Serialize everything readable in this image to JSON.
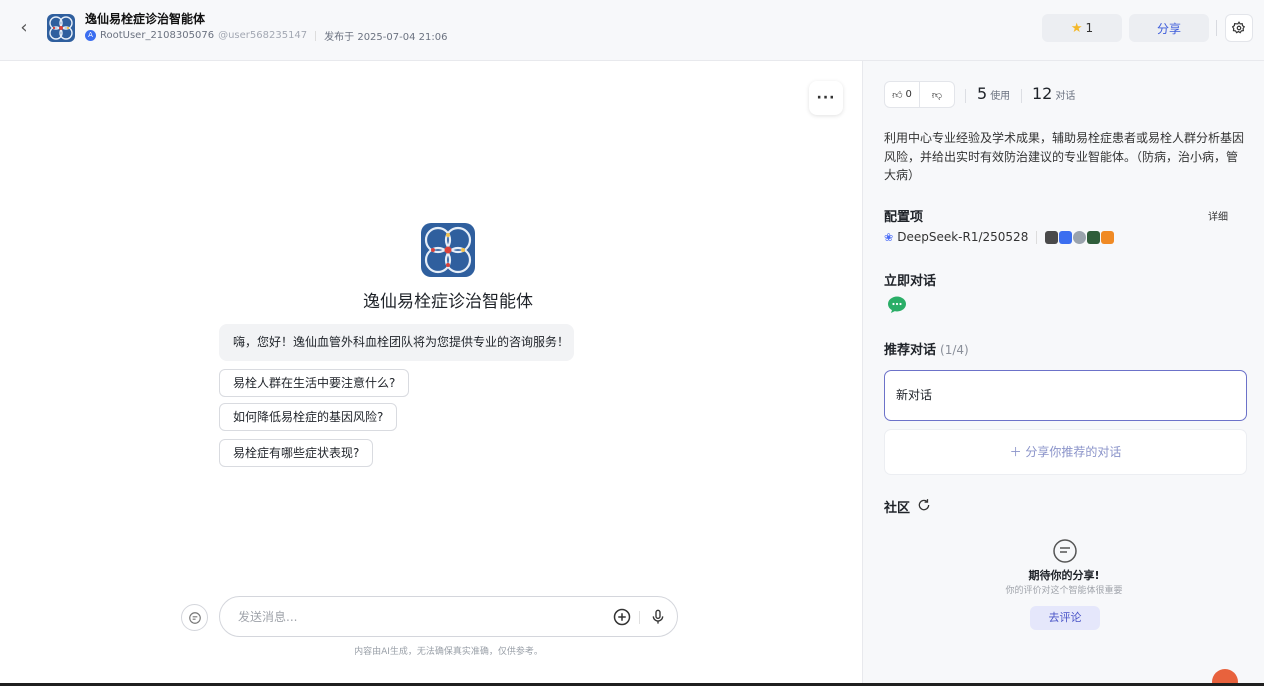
{
  "header": {
    "title": "逸仙易栓症诊治智能体",
    "author": "RootUser_2108305076",
    "handle": "@user568235147",
    "published": "发布于 2025-07-04 21:06",
    "star_count": "1",
    "share_label": "分享"
  },
  "chat": {
    "agent_name": "逸仙易栓症诊治智能体",
    "greeting": "嗨，您好！逸仙血管外科血栓团队将为您提供专业的咨询服务！",
    "suggestions": [
      "易栓人群在生活中要注意什么?",
      "如何降低易栓症的基因风险?",
      "易栓症有哪些症状表现?"
    ],
    "input_placeholder": "发送消息...",
    "disclaimer": "内容由AI生成，无法确保真实准确，仅供参考。"
  },
  "sidebar": {
    "likes": "0",
    "uses": "5",
    "uses_label": "使用",
    "dialogs": "12",
    "dialogs_label": "对话",
    "description": "利用中心专业经验及学术成果，辅助易栓症患者或易栓人群分析基因风险，并给出实时有效防治建议的专业智能体。（防病，治小病，管大病）",
    "config_title": "配置项",
    "detail_link": "详细",
    "model": "DeepSeek-R1/250528",
    "plugin_colors": [
      "#4a4a4a",
      "#3b6ef0",
      "#9aa3ad",
      "#2f5d3a",
      "#f08a24"
    ],
    "instant_title": "立即对话",
    "wechat_color": "#2aae67",
    "recommend_title": "推荐对话",
    "recommend_count": "(1/4)",
    "new_conversation": "新对话",
    "add_recommend": "＋ 分享你推荐的对话",
    "community_title": "社区",
    "empty_title": "期待你的分享!",
    "empty_sub": "你的评价对这个智能体很重要",
    "go_button": "去评论"
  }
}
